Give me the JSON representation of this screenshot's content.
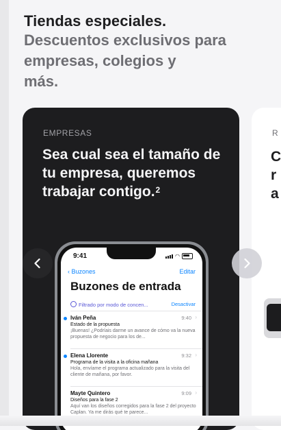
{
  "header": {
    "title": "Tiendas especiales.",
    "subtitle_lines": [
      "Descuentos exclusivos para",
      "empresas, colegios y",
      "más."
    ]
  },
  "card": {
    "eyebrow": "EMPRESAS",
    "headline_lines": [
      "Sea cual sea el tamaño de",
      "tu empresa, queremos",
      "trabajar contigo."
    ],
    "footnote": "2"
  },
  "phone": {
    "time": "9:41",
    "back_label": "Buzones",
    "edit_label": "Editar",
    "inbox_title": "Buzones de entrada",
    "filter_text": "Filtrado por modo de concen...",
    "filter_action": "Desactivar",
    "emails": [
      {
        "from": "Iván Peña",
        "time": "9:40",
        "subject": "Estado de la propuesta",
        "preview": "¡Buenas! ¿Podríais darme un avance de cómo va la nueva propuesta de negocio para los de...",
        "unread": true
      },
      {
        "from": "Elena Llorente",
        "time": "9:32",
        "subject": "Programa de la visita a la oficina mañana",
        "preview": "Hola, envíame el programa actualizado para la visita del cliente de mañana, por favor.",
        "unread": true
      },
      {
        "from": "Mayte Quintero",
        "time": "9:09",
        "subject": "Diseños para la fase 2",
        "preview": "Aquí van los diseños corregidos para la fase 2 del proyecto Caplan. Ya me dirás qué te parece...",
        "unread": false
      }
    ]
  },
  "card2": {
    "eyebrow": "R",
    "headline_lines": [
      "C",
      "r",
      "a"
    ]
  },
  "icons": {
    "prev": "chevron-left-icon",
    "next": "chevron-right-icon"
  },
  "colors": {
    "card_bg": "#1d1d1f",
    "accent_blue": "#0a84ff",
    "filter_purple": "#5856d6"
  }
}
